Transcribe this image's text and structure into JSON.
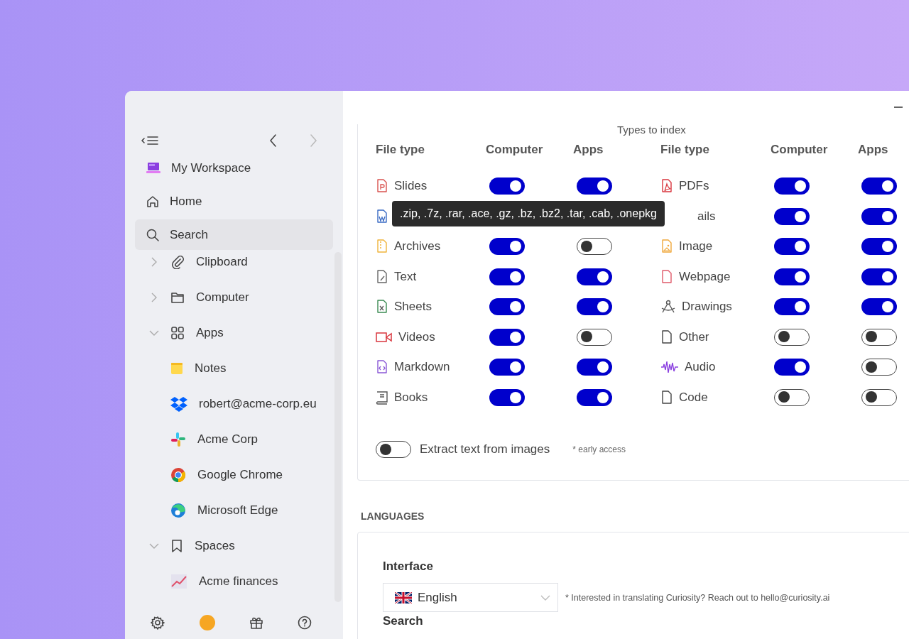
{
  "sidebar": {
    "nav": [
      {
        "label": "My Workspace",
        "kind": "workspace",
        "selected": false
      },
      {
        "label": "Home",
        "kind": "home",
        "selected": false
      },
      {
        "label": "Search",
        "kind": "search",
        "selected": true
      }
    ],
    "tree": [
      {
        "label": "Clipboard",
        "kind": "clip",
        "expanded": false
      },
      {
        "label": "Computer",
        "kind": "folder",
        "expanded": false
      },
      {
        "label": "Apps",
        "kind": "apps",
        "expanded": true,
        "children": [
          {
            "label": "Notes",
            "kind": "notes"
          },
          {
            "label": "robert@acme-corp.eu",
            "kind": "dropbox"
          },
          {
            "label": "Acme Corp",
            "kind": "slack"
          },
          {
            "label": "Google Chrome",
            "kind": "chrome"
          },
          {
            "label": "Microsoft Edge",
            "kind": "edge"
          }
        ]
      },
      {
        "label": "Spaces",
        "kind": "bookmark",
        "expanded": true,
        "children": [
          {
            "label": "Acme finances",
            "kind": "chart"
          }
        ]
      }
    ]
  },
  "index_card": {
    "title": "Types to index",
    "groups": [
      {
        "columns": [
          "File type",
          "Computer",
          "Apps"
        ],
        "rows": [
          {
            "kind": "slides",
            "label": "Slides",
            "computer": true,
            "apps": true
          },
          {
            "kind": "word"
          },
          {
            "kind": "archive",
            "label": "Archives",
            "computer": true,
            "apps": false
          },
          {
            "kind": "text",
            "label": "Text",
            "computer": true,
            "apps": true
          },
          {
            "kind": "sheet",
            "label": "Sheets",
            "computer": true,
            "apps": true
          },
          {
            "kind": "video",
            "label": "Videos",
            "computer": true,
            "apps": false
          },
          {
            "kind": "markdown",
            "label": "Markdown",
            "computer": true,
            "apps": true
          },
          {
            "kind": "book",
            "label": "Books",
            "computer": true,
            "apps": true
          }
        ]
      },
      {
        "columns": [
          "File type",
          "Computer",
          "Apps"
        ],
        "rows": [
          {
            "kind": "pdf",
            "label": "PDFs",
            "computer": true,
            "apps": true
          },
          {
            "label": "ails",
            "computer": true,
            "apps": true
          },
          {
            "kind": "image",
            "label": "Image",
            "computer": true,
            "apps": true
          },
          {
            "kind": "webpage",
            "label": "Webpage",
            "computer": true,
            "apps": true
          },
          {
            "kind": "drawing",
            "label": "Drawings",
            "computer": true,
            "apps": true
          },
          {
            "kind": "file",
            "label": "Other",
            "computer": false,
            "apps": false
          },
          {
            "kind": "audio",
            "label": "Audio",
            "computer": true,
            "apps": false
          },
          {
            "kind": "file",
            "label": "Code",
            "computer": false,
            "apps": false
          }
        ]
      }
    ],
    "tooltip": ".zip, .7z, .rar, .ace, .gz, .bz, .bz2, .tar, .cab, .onepkg",
    "extract": {
      "on": false,
      "label": "Extract text from images",
      "note": "* early access"
    }
  },
  "languages": {
    "heading": "LANGUAGES",
    "interface_label": "Interface",
    "value": "English",
    "note": "* Interested in translating Curiosity? Reach out to hello@curiosity.ai",
    "search_label": "Search"
  }
}
